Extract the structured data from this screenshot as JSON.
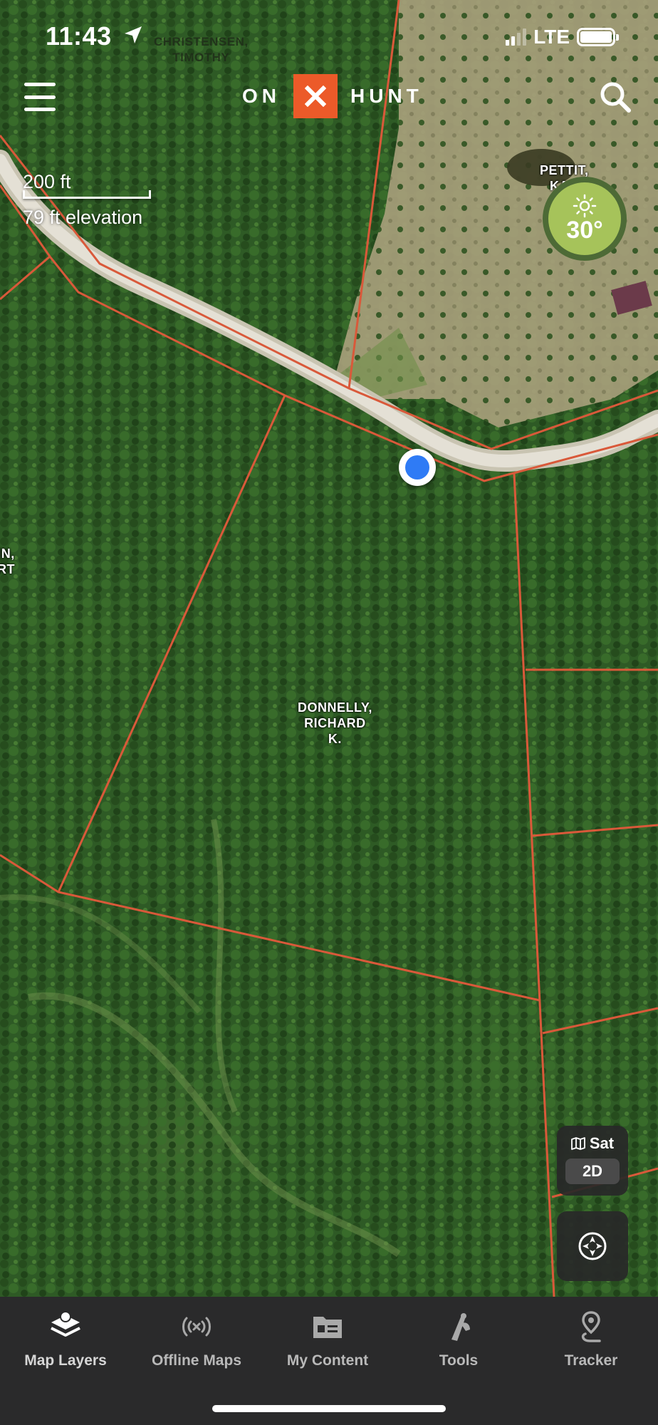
{
  "status_bar": {
    "time": "11:43",
    "network": "LTE",
    "owner_label_top": "CHRISTENSEN,\nTIMOTHY"
  },
  "header": {
    "logo_left": "ON",
    "logo_mark": "✕",
    "logo_right": "HUNT",
    "menu_icon": "hamburger-icon",
    "search_icon": "search-icon"
  },
  "map": {
    "scale_label": "200 ft",
    "elevation": "79 ft elevation",
    "weather": {
      "temperature": "30°",
      "condition_icon": "sun-icon"
    },
    "owners": {
      "pettit": "PETTIT,\nKAR",
      "left_partial": "IN,\nRT",
      "donnelly": "DONNELLY,\nRICHARD\nK."
    },
    "colors": {
      "parcel_line": "#d9593a",
      "road": "#d9d4c6",
      "user_dot": "#2f7bf5",
      "logo_accent": "#ec5a29"
    }
  },
  "controls": {
    "map_type_label": "Sat",
    "map_mode": "2D",
    "recenter_icon": "compass-icon"
  },
  "tabbar": {
    "items": [
      {
        "label": "Map Layers",
        "icon": "layers-icon"
      },
      {
        "label": "Offline Maps",
        "icon": "offline-icon"
      },
      {
        "label": "My Content",
        "icon": "folder-icon"
      },
      {
        "label": "Tools",
        "icon": "tools-icon"
      },
      {
        "label": "Tracker",
        "icon": "tracker-icon"
      }
    ]
  }
}
